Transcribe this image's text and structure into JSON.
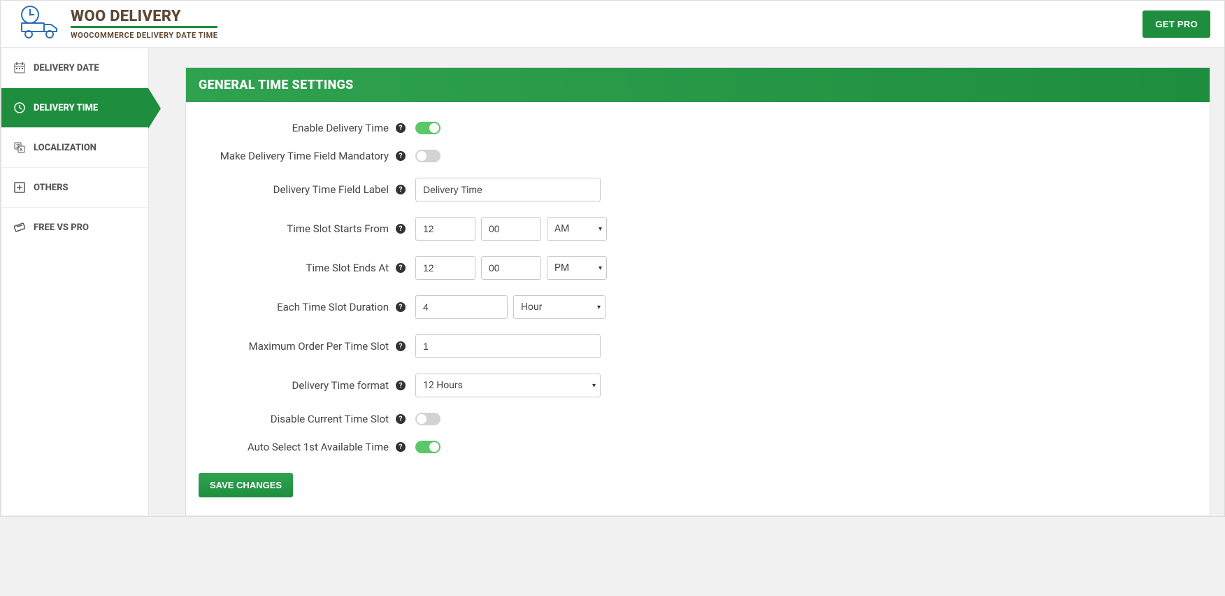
{
  "header": {
    "title": "WOO DELIVERY",
    "subtitle": "WOOCOMMERCE DELIVERY DATE TIME",
    "get_pro_label": "GET PRO"
  },
  "sidebar": {
    "items": [
      {
        "icon": "calendar-icon",
        "label": "DELIVERY DATE",
        "active": false
      },
      {
        "icon": "clock-icon",
        "label": "DELIVERY TIME",
        "active": true
      },
      {
        "icon": "localization-icon",
        "label": "LOCALIZATION",
        "active": false
      },
      {
        "icon": "others-icon",
        "label": "OTHERS",
        "active": false
      },
      {
        "icon": "compare-icon",
        "label": "FREE VS PRO",
        "active": false
      }
    ]
  },
  "panel": {
    "title": "GENERAL TIME SETTINGS",
    "save_label": "SAVE CHANGES",
    "fields": {
      "enable_delivery_time": {
        "label": "Enable Delivery Time",
        "value": true
      },
      "mandatory": {
        "label": "Make Delivery Time Field Mandatory",
        "value": false
      },
      "field_label": {
        "label": "Delivery Time Field Label",
        "value": "Delivery Time"
      },
      "starts_from": {
        "label": "Time Slot Starts From",
        "hour": "12",
        "minute": "00",
        "ampm": "AM"
      },
      "ends_at": {
        "label": "Time Slot Ends At",
        "hour": "12",
        "minute": "00",
        "ampm": "PM"
      },
      "duration": {
        "label": "Each Time Slot Duration",
        "value": "4",
        "unit": "Hour"
      },
      "max_order": {
        "label": "Maximum Order Per Time Slot",
        "value": "1"
      },
      "time_format": {
        "label": "Delivery Time format",
        "value": "12 Hours"
      },
      "disable_current": {
        "label": "Disable Current Time Slot",
        "value": false
      },
      "auto_select": {
        "label": "Auto Select 1st Available Time",
        "value": true
      }
    }
  }
}
